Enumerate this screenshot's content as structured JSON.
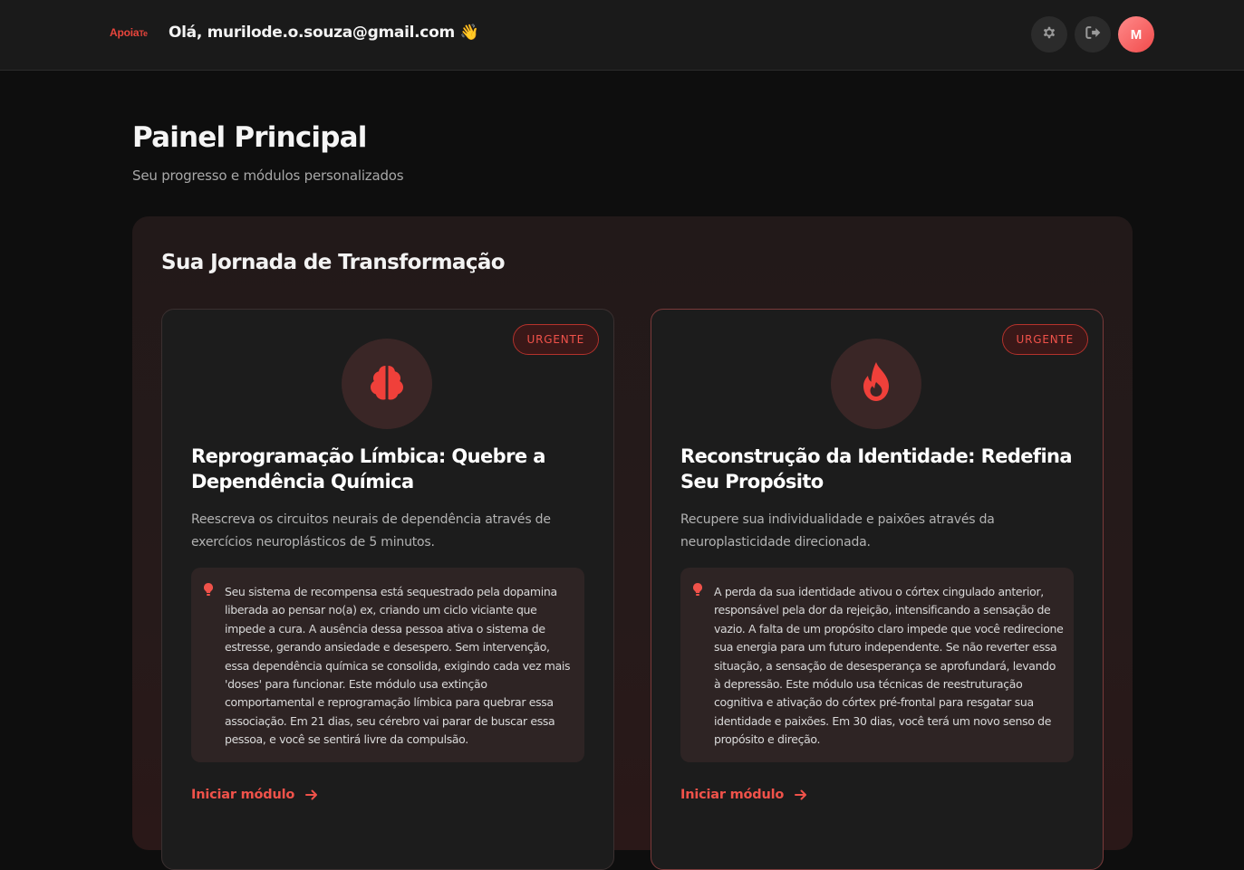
{
  "header": {
    "logo_main": "Apoia",
    "logo_accent": "Te",
    "greeting": "Olá, murilode.o.souza@gmail.com",
    "wave_emoji": "👋",
    "settings_icon": "gear-icon",
    "logout_icon": "logout-icon",
    "avatar_initial": "M"
  },
  "page": {
    "title": "Painel Principal",
    "subtitle": "Seu progresso e módulos personalizados"
  },
  "journey": {
    "title": "Sua Jornada de Transformação",
    "modules": [
      {
        "badge": "URGENTE",
        "icon": "brain-icon",
        "title": "Reprogramação Límbica: Quebre a Dependência Química",
        "description": "Reescreva os circuitos neurais de dependência através de exercícios neuroplásticos de 5 minutos.",
        "insight": "Seu sistema de recompensa está sequestrado pela dopamina liberada ao pensar no(a) ex, criando um ciclo viciante que impede a cura. A ausência dessa pessoa ativa o sistema de estresse, gerando ansiedade e desespero. Sem intervenção, essa dependência química se consolida, exigindo cada vez mais 'doses' para funcionar. Este módulo usa extinção comportamental e reprogramação límbica para quebrar essa associação. Em 21 dias, seu cérebro vai parar de buscar essa pessoa, e você se sentirá livre da compulsão.",
        "action": "Iniciar módulo"
      },
      {
        "badge": "URGENTE",
        "icon": "fire-icon",
        "title": "Reconstrução da Identidade: Redefina Seu Propósito",
        "description": "Recupere sua individualidade e paixões através da neuroplasticidade direcionada.",
        "insight": "A perda da sua identidade ativou o córtex cingulado anterior, responsável pela dor da rejeição, intensificando a sensação de vazio. A falta de um propósito claro impede que você redirecione sua energia para um futuro independente. Se não reverter essa situação, a sensação de desesperança se aprofundará, levando à depressão. Este módulo usa técnicas de reestruturação cognitiva e ativação do córtex pré-frontal para resgatar sua identidade e paixões. Em 30 dias, você terá um novo senso de propósito e direção.",
        "action": "Iniciar módulo"
      }
    ]
  },
  "colors": {
    "accent": "#f0524a",
    "background": "#0e0e0e",
    "topbar": "#1a1a1a",
    "card": "#1c1c1c"
  }
}
